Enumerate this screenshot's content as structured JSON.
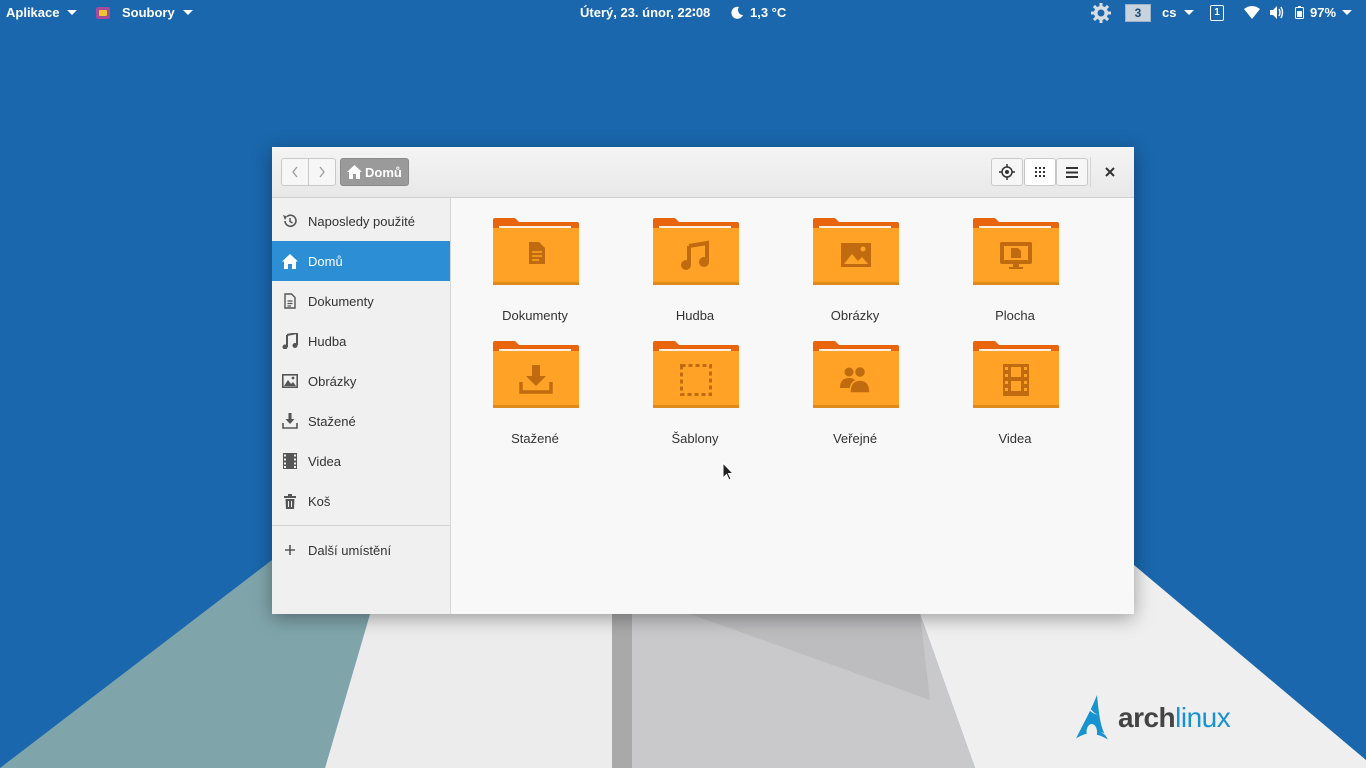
{
  "topbar": {
    "apps_menu": "Aplikace",
    "files_menu": "Soubory",
    "clock": "Úterý, 23. únor, 22∶08",
    "weather": "1,3 °C",
    "workspace": "3",
    "keyboard_layout": "cs",
    "keyboard_indicator": "1",
    "battery": "97%"
  },
  "window": {
    "path_label": "Domů",
    "sidebar": {
      "items": [
        {
          "label": "Naposledy použité",
          "icon": "history-icon"
        },
        {
          "label": "Domů",
          "icon": "home-icon",
          "active": true
        },
        {
          "label": "Dokumenty",
          "icon": "document-icon"
        },
        {
          "label": "Hudba",
          "icon": "music-icon"
        },
        {
          "label": "Obrázky",
          "icon": "image-icon"
        },
        {
          "label": "Stažené",
          "icon": "download-icon"
        },
        {
          "label": "Videa",
          "icon": "video-icon"
        },
        {
          "label": "Koš",
          "icon": "trash-icon"
        }
      ],
      "other_locations": "Další umístění"
    },
    "folders": [
      {
        "label": "Dokumenty",
        "icon": "document-icon"
      },
      {
        "label": "Hudba",
        "icon": "music-icon"
      },
      {
        "label": "Obrázky",
        "icon": "image-icon"
      },
      {
        "label": "Plocha",
        "icon": "desktop-icon"
      },
      {
        "label": "Stažené",
        "icon": "download-icon"
      },
      {
        "label": "Šablony",
        "icon": "template-icon"
      },
      {
        "label": "Veřejné",
        "icon": "people-icon"
      },
      {
        "label": "Videa",
        "icon": "video-icon"
      }
    ]
  },
  "wallpaper": {
    "logo_left": "arch",
    "logo_right": "linux"
  },
  "colors": {
    "desktop_blue": "#1a67ad",
    "selection_blue": "#2c8fd6",
    "folder_orange": "#ffa226",
    "folder_dark_orange": "#e8650c"
  }
}
